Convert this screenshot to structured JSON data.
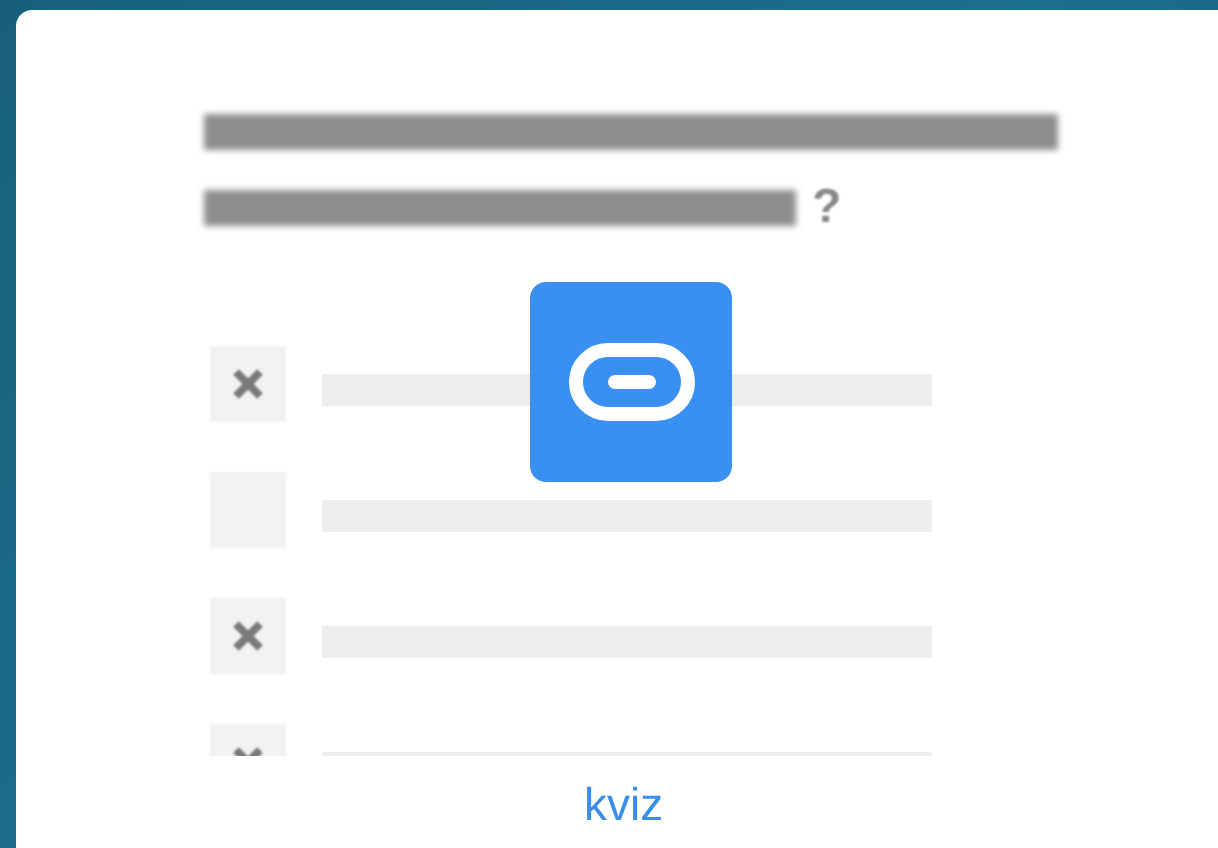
{
  "question": {
    "mark": "?"
  },
  "options": [
    {
      "checked": true
    },
    {
      "checked": false
    },
    {
      "checked": true
    },
    {
      "checked": true
    }
  ],
  "caption": "kviz"
}
